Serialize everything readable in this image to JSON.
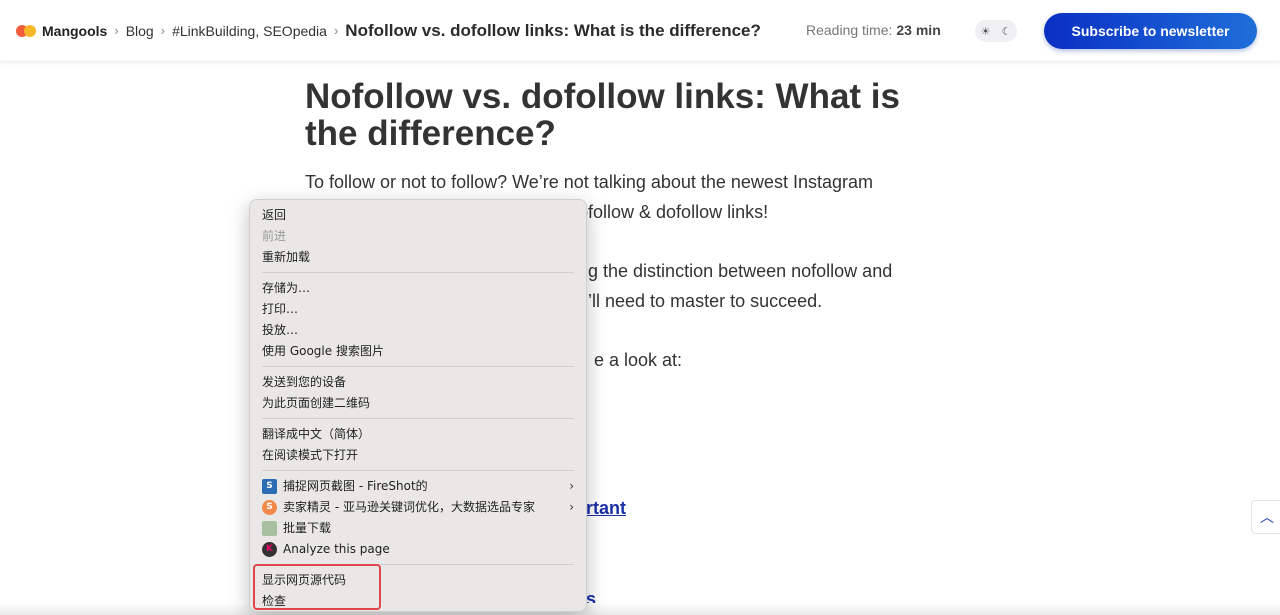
{
  "header": {
    "logo": "Mangools",
    "breadcrumbs": [
      "Blog",
      "#LinkBuilding, SEOpedia"
    ],
    "current": "Nofollow vs. dofollow links: What is the difference?",
    "reading_label": "Reading time:",
    "reading_value": "23 min",
    "theme_icons": [
      "sun-icon",
      "moon-icon"
    ],
    "subscribe": "Subscribe to newsletter",
    "accent": "#0a2fc4"
  },
  "article": {
    "title": "Nofollow vs. dofollow links: What is the difference?",
    "p1a": "To follow or not to follow? We’re not talking about the newest Instagram",
    "p1b": "ofollow & dofollow links!",
    "p2a": "ng the distinction between nofollow and",
    "p2b": "u’ll need to master to succeed.",
    "p3": "e a look at:",
    "link1": "rtant",
    "link2": "s"
  },
  "menu": {
    "items": [
      {
        "label": "返回",
        "disabled": false
      },
      {
        "label": "前进",
        "disabled": true
      },
      {
        "label": "重新加载",
        "disabled": false
      },
      {
        "label": "存储为…"
      },
      {
        "label": "打印…"
      },
      {
        "label": "投放…"
      },
      {
        "label": "使用 Google 搜索图片"
      },
      {
        "label": "发送到您的设备"
      },
      {
        "label": "为此页面创建二维码"
      },
      {
        "label": "翻译成中文（简体）"
      },
      {
        "label": "在阅读模式下打开"
      },
      {
        "label": "捕捉网页截图 - FireShot的"
      },
      {
        "label": "卖家精灵 - 亚马逊关键词优化，大数据选品专家"
      },
      {
        "label": "批量下载"
      },
      {
        "label": "Analyze this page"
      },
      {
        "label": "显示网页源代码"
      },
      {
        "label": "检查"
      }
    ],
    "highlight_color": "#e0474c"
  }
}
